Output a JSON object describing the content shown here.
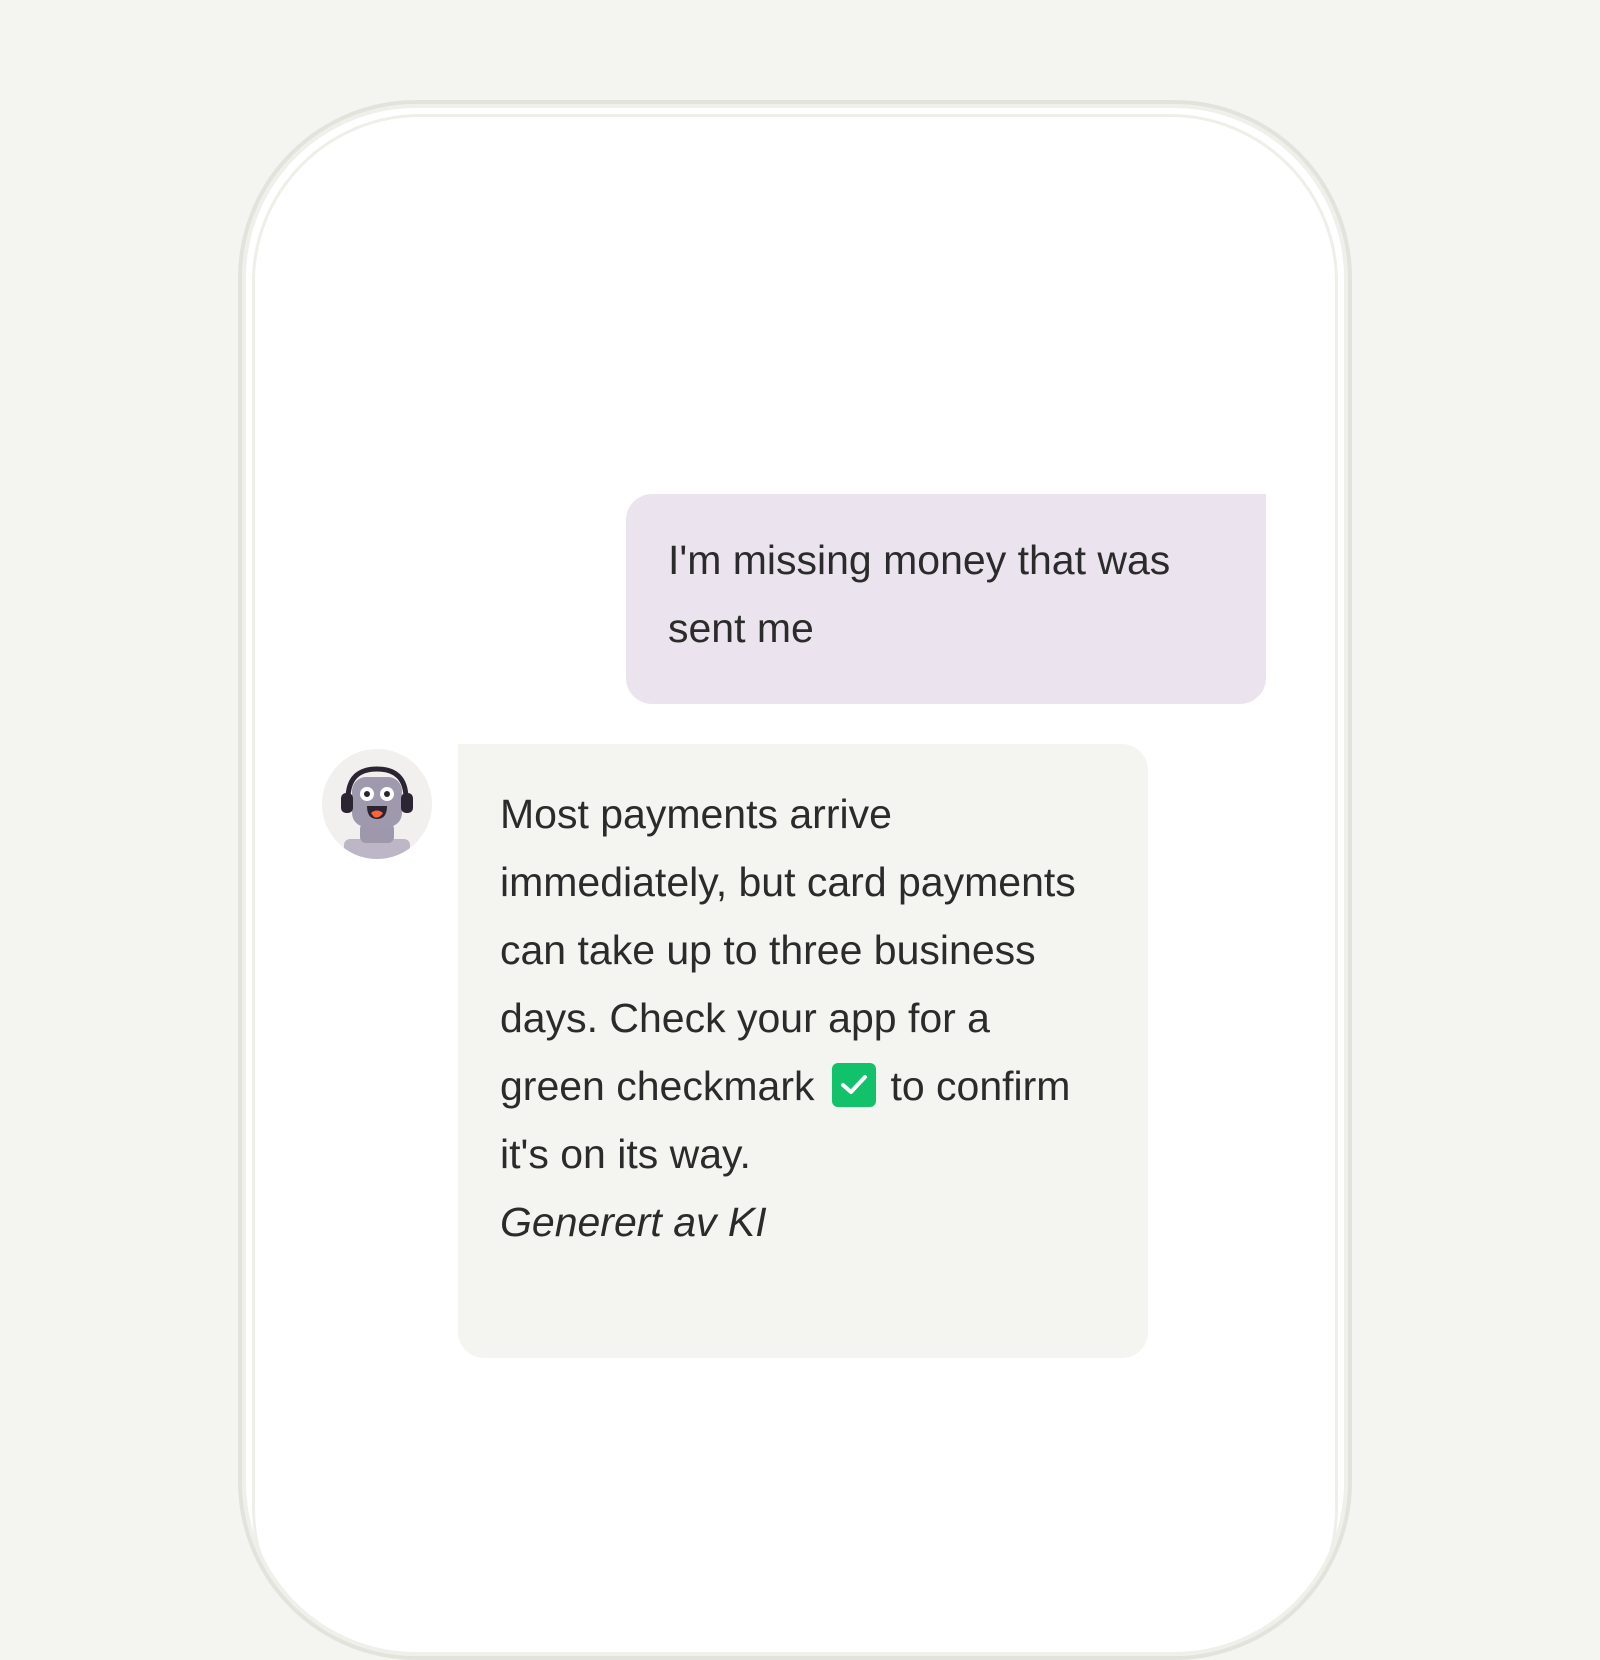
{
  "chat": {
    "user_message": "I'm missing money that was sent me",
    "bot_message_part1": "Most payments arrive immediately, but card payments can take up to three business days. Check your app for a green checkmark",
    "bot_message_part2": "to confirm it's on its way.",
    "bot_label": "Generert av KI",
    "inline_icon": "green-checkmark-icon",
    "avatar_icon": "robot-support-agent-icon"
  },
  "colors": {
    "page_background": "#f4f4f0",
    "phone_frame": "#e3e3dd",
    "user_bubble": "#ebe4ee",
    "bot_bubble": "#f4f4f0",
    "checkmark_green": "#12c26a",
    "text": "#2b2b2b"
  }
}
